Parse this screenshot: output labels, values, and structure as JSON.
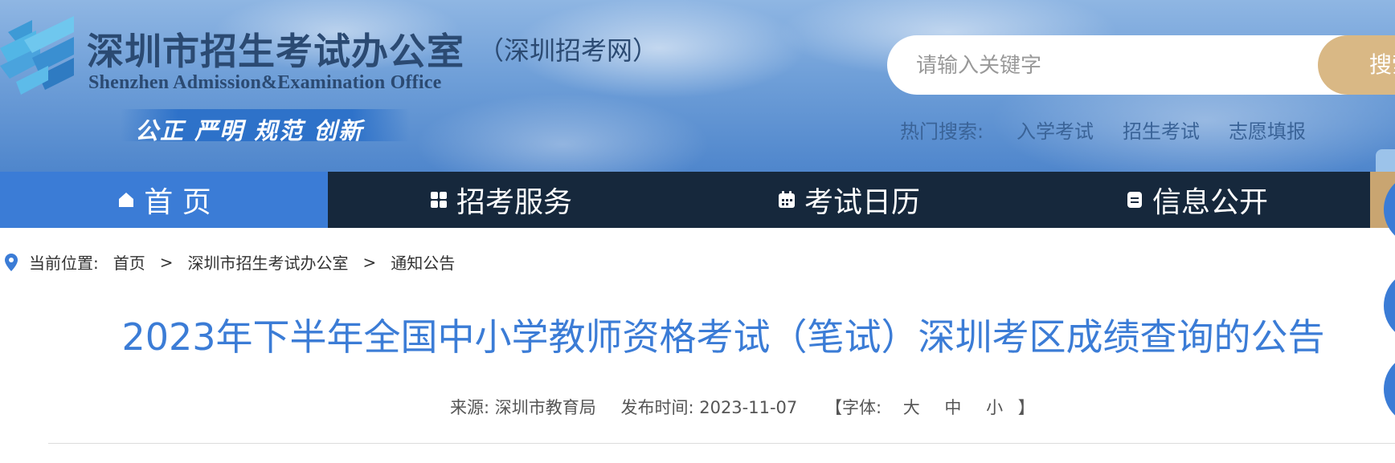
{
  "header": {
    "title_cn": "深圳市招生考试办公室",
    "subtitle_cn": "（深圳招考网）",
    "title_en": "Shenzhen Admission&Examination Office",
    "motto": "公正  严明  规范  创新"
  },
  "search": {
    "placeholder": "请输入关键字",
    "button_label": "搜索"
  },
  "hot_search": {
    "label": "热门搜索:",
    "links": [
      "入学考试",
      "招生考试",
      "志愿填报"
    ]
  },
  "nav": {
    "items": [
      {
        "label": "首 页",
        "icon": "home-icon",
        "active": true
      },
      {
        "label": "招考服务",
        "icon": "grid-icon",
        "active": false
      },
      {
        "label": "考试日历",
        "icon": "calendar-icon",
        "active": false
      },
      {
        "label": "信息公开",
        "icon": "document-icon",
        "active": false
      }
    ]
  },
  "breadcrumb": {
    "icon": "location-pin-icon",
    "label": "当前位置:",
    "items": [
      "首页",
      "深圳市招生考试办公室",
      "通知公告"
    ],
    "separator": ">"
  },
  "article": {
    "title": "2023年下半年全国中小学教师资格考试（笔试）深圳考区成绩查询的公告",
    "source_label": "来源:",
    "source_value": "深圳市教育局",
    "date_label": "发布时间:",
    "date_value": "2023-11-07",
    "font_open": "【字体:",
    "font_sizes": [
      "大",
      "中",
      "小"
    ],
    "font_close": "】"
  },
  "colors": {
    "accent": "#3b7cd6",
    "nav_bg": "#16283c",
    "search_button": "#d9b885",
    "title_text": "#3b7cd6"
  }
}
